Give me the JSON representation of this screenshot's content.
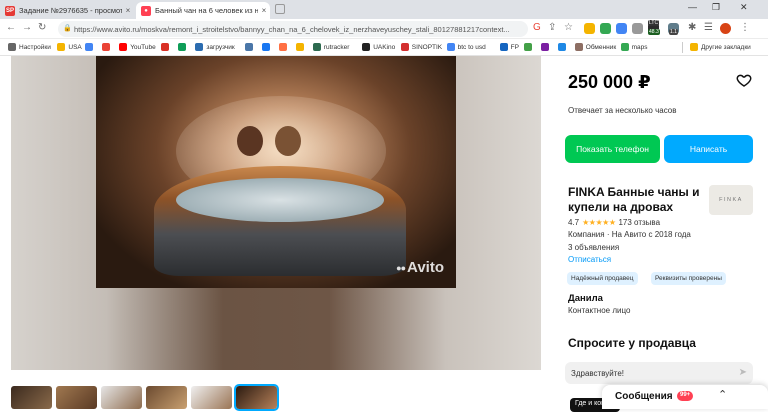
{
  "browser": {
    "tabs": [
      {
        "favicon": "SP",
        "title": "Задание №2976635 - просмотр з",
        "close": "×"
      },
      {
        "favicon": "avito",
        "title": "Банный чан на 6 человек из нерж",
        "close": "×"
      }
    ],
    "url": "https://www.avito.ru/moskva/remont_i_stroitelstvo/bannyy_chan_na_6_chelovek_iz_nerzhaveyuschey_stali_801278812​17context...",
    "bookmarks": [
      {
        "label": "Настройки",
        "color": "#666666"
      },
      {
        "label": "USA",
        "color": "#f4b400"
      },
      {
        "label": "",
        "color": "#4285f4"
      },
      {
        "label": "",
        "color": "#ea4335"
      },
      {
        "label": "YouTube",
        "color": "#ff0000"
      },
      {
        "label": "",
        "color": "#d93025"
      },
      {
        "label": "",
        "color": "#0f9d58"
      },
      {
        "label": "загрузчик",
        "color": "#2b6cb0"
      },
      {
        "label": "",
        "color": "#4a76a8"
      },
      {
        "label": "",
        "color": "#1877f2"
      },
      {
        "label": "",
        "color": "#ff7043"
      },
      {
        "label": "",
        "color": "#f4b400"
      },
      {
        "label": "rutracker",
        "color": "#2d6a4f"
      },
      {
        "label": "UAKino",
        "color": "#222222"
      },
      {
        "label": "SINOPTIK",
        "color": "#d32f2f"
      },
      {
        "label": "btc to usd",
        "color": "#4285f4"
      },
      {
        "label": "FP",
        "color": "#1565c0"
      },
      {
        "label": "",
        "color": "#43a047"
      },
      {
        "label": "",
        "color": "#7b1fa2"
      },
      {
        "label": "",
        "color": "#1e88e5"
      },
      {
        "label": "Обменник",
        "color": "#8d6e63"
      },
      {
        "label": "maps",
        "color": "#34a853"
      }
    ],
    "other_bookmarks": "Другие закладки",
    "extension_badges": {
      "ltc": "LTC",
      "ltc_value": "48.3",
      "alt_value": "1.1"
    }
  },
  "listing": {
    "price": "250 000 ₽",
    "response_time": "Отвечает за несколько часов",
    "show_phone_label": "Показать телефон",
    "write_label": "Написать",
    "photo_watermark": "Avito",
    "thumbnail_count": 6,
    "selected_thumbnail": 6
  },
  "seller": {
    "name": "FINKA Банные чаны и купели на дровах",
    "logo_text": "FINKA",
    "rating": "4.7",
    "stars": "★★★★★",
    "reviews": "173 отзыва",
    "company": "Компания · На Авито с 2018 года",
    "ads_count": "3 объявления",
    "unsubscribe": "Отписаться",
    "badges": [
      "Надёжный продавец",
      "Реквизиты проверены"
    ],
    "contact_name": "Данила",
    "contact_role": "Контактное лицо"
  },
  "ask": {
    "title": "Спросите у продавца",
    "input_value": "Здравствуйте!",
    "chip": "Где и ког"
  },
  "messages": {
    "label": "Сообщения",
    "count": "99+"
  },
  "colors": {
    "green": "#00c853",
    "blue": "#00aaff",
    "link": "#0099f7",
    "badge_bg": "#dff1ff",
    "counter": "#ff4053"
  }
}
